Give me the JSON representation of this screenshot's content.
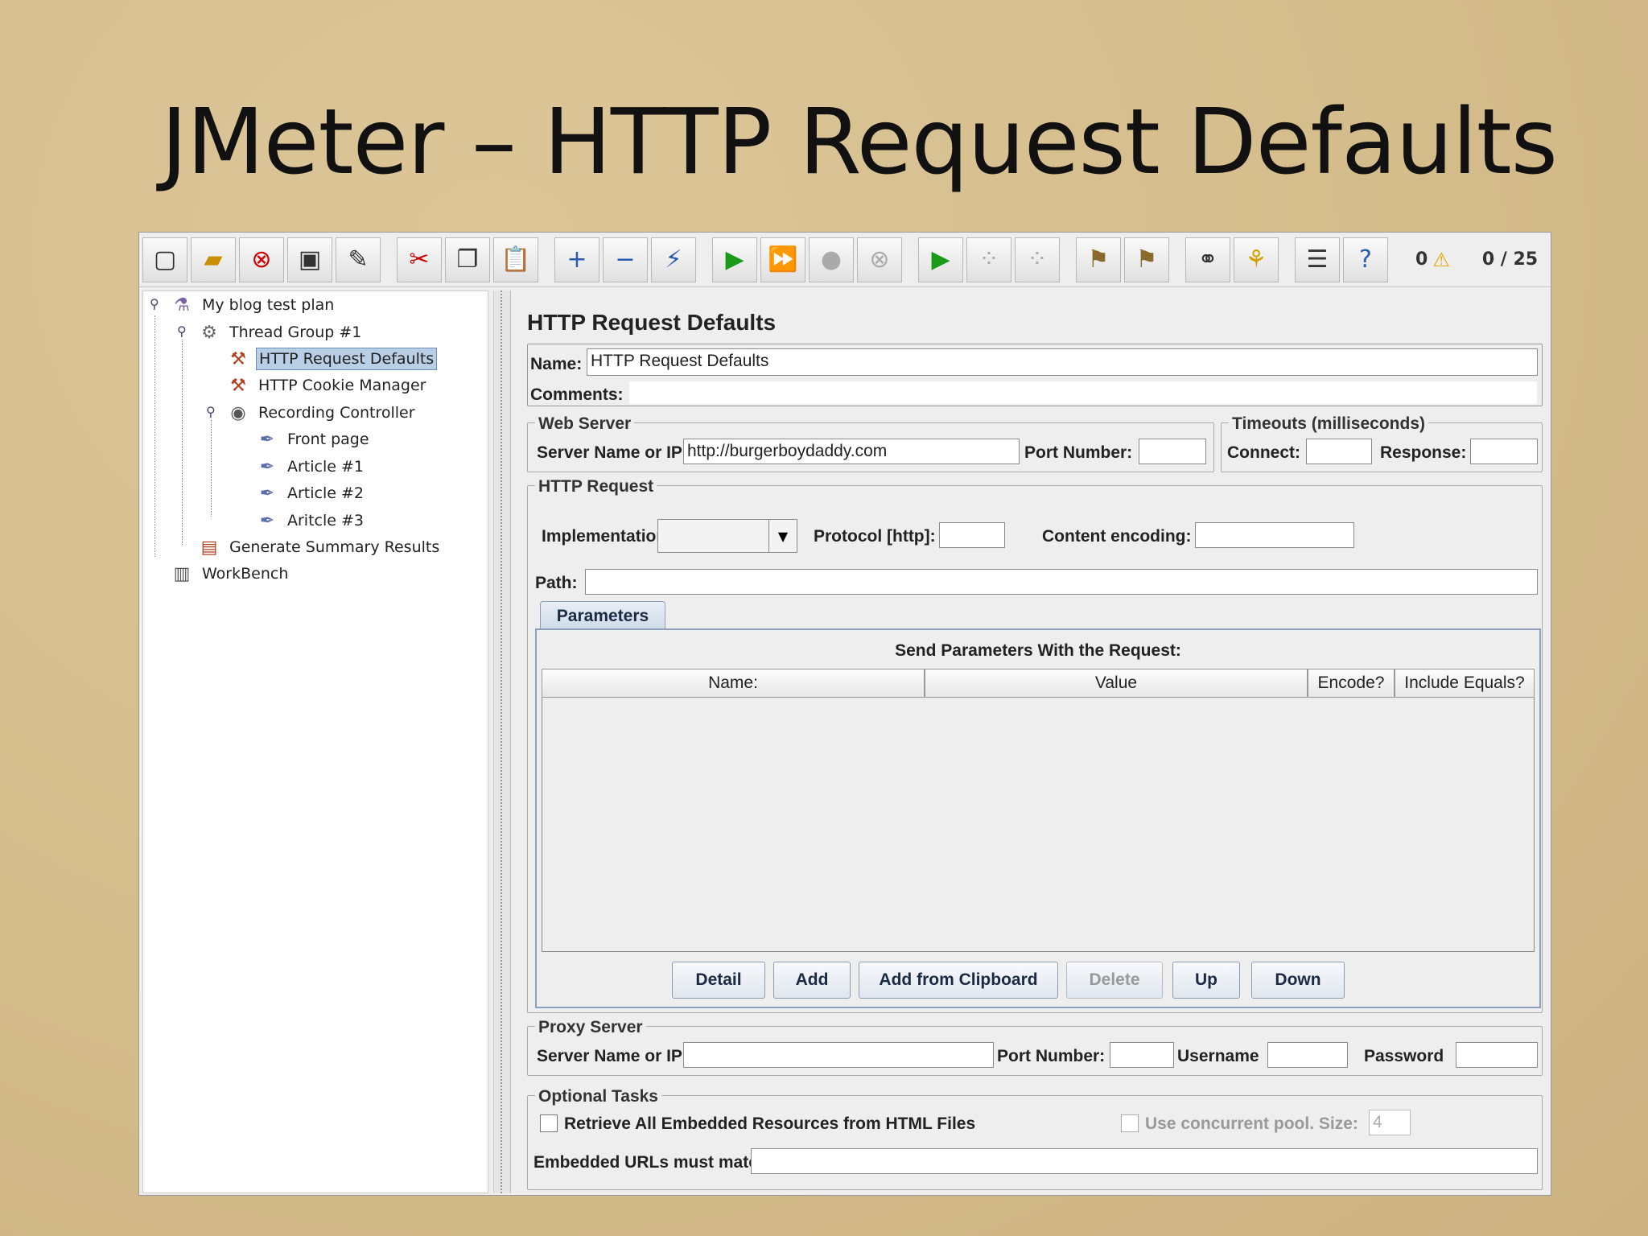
{
  "slide": {
    "title": "JMeter – HTTP Request Defaults"
  },
  "toolbar": {
    "buttons": [
      "new-icon",
      "open-icon",
      "close-icon",
      "save-icon",
      "save-as-icon",
      "cut-icon",
      "copy-icon",
      "paste-icon",
      "expand-icon",
      "collapse-icon",
      "toggle-icon",
      "start-icon",
      "start-no-pause-icon",
      "stop-icon",
      "shutdown-icon",
      "remote-start-icon",
      "remote-stop-icon",
      "remote-shutdown-icon",
      "clear-icon",
      "clear-all-icon",
      "search-icon",
      "reset-search-icon",
      "function-helper-icon",
      "help-icon"
    ],
    "error_count": "0",
    "threads": "0 / 25"
  },
  "tree": {
    "nodes": [
      {
        "label": "My blog test plan",
        "icon": "test-plan-icon"
      },
      {
        "label": "Thread Group #1",
        "icon": "thread-group-icon"
      },
      {
        "label": "HTTP Request Defaults",
        "icon": "config-element-icon",
        "selected": true
      },
      {
        "label": "HTTP Cookie Manager",
        "icon": "config-element-icon"
      },
      {
        "label": "Recording Controller",
        "icon": "controller-icon"
      },
      {
        "label": "Front page",
        "icon": "sampler-icon"
      },
      {
        "label": "Article #1",
        "icon": "sampler-icon"
      },
      {
        "label": "Article #2",
        "icon": "sampler-icon"
      },
      {
        "label": "Aritcle #3",
        "icon": "sampler-icon"
      },
      {
        "label": "Generate Summary Results",
        "icon": "listener-icon"
      },
      {
        "label": "WorkBench",
        "icon": "workbench-icon"
      }
    ]
  },
  "panel": {
    "title": "HTTP Request Defaults",
    "name_label": "Name:",
    "name_value": "HTTP Request Defaults",
    "comments_label": "Comments:",
    "web_server": {
      "title": "Web Server",
      "server_label": "Server Name or IP:",
      "server_value": "http://burgerboydaddy.com",
      "port_label": "Port Number:"
    },
    "timeouts": {
      "title": "Timeouts (milliseconds)",
      "connect_label": "Connect:",
      "response_label": "Response:"
    },
    "http_request": {
      "title": "HTTP Request",
      "implementation_label": "Implementation:",
      "protocol_label": "Protocol [http]:",
      "encoding_label": "Content encoding:",
      "path_label": "Path:"
    },
    "parameters": {
      "tab": "Parameters",
      "caption": "Send Parameters With the Request:",
      "columns": [
        "Name:",
        "Value",
        "Encode?",
        "Include Equals?"
      ],
      "buttons": [
        "Detail",
        "Add",
        "Add from Clipboard",
        "Delete",
        "Up",
        "Down"
      ]
    },
    "proxy": {
      "title": "Proxy Server",
      "server_label": "Server Name or IP:",
      "port_label": "Port Number:",
      "username_label": "Username",
      "password_label": "Password"
    },
    "optional": {
      "title": "Optional Tasks",
      "retrieve_label": "Retrieve All Embedded Resources from HTML Files",
      "concurrent_label": "Use concurrent pool. Size:",
      "concurrent_size": "4",
      "embedded_label": "Embedded URLs must match:"
    }
  }
}
